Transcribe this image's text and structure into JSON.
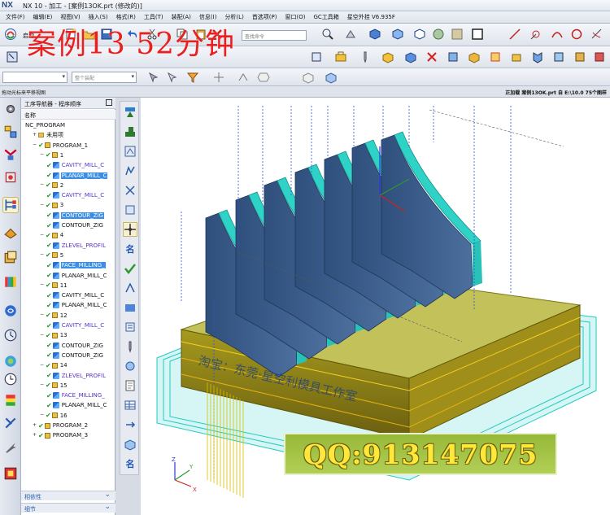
{
  "window": {
    "logo": "NX",
    "title": "NX 10 - 加工 - [案例13OK.prt (修改的)]"
  },
  "menu": [
    "文件(F)",
    "编辑(E)",
    "视图(V)",
    "插入(S)",
    "格式(R)",
    "工具(T)",
    "装配(A)",
    "信息(I)",
    "分析(L)",
    "首选项(P)",
    "窗口(O)",
    "GC工具箱",
    "星空外挂 V6.935F"
  ],
  "toolbar": {
    "start_label": "启动",
    "command_finder_placeholder": "查找命令",
    "filter_dropdown": "",
    "assembly_dropdown": "整个装配"
  },
  "watermark": "案例13  52分钟",
  "status": {
    "left": "拖动光标来平移视图",
    "right": "正加载 案例13OK.prt 自 E:\\10.0  75个图样"
  },
  "navigator": {
    "title": "工序导航器 - 程序顺序",
    "column": "名称",
    "rows": [
      {
        "level": 0,
        "text": "NC_PROGRAM",
        "kind": "root"
      },
      {
        "level": 1,
        "text": "未用项",
        "kind": "folder"
      },
      {
        "level": 1,
        "text": "PROGRAM_1",
        "kind": "program"
      },
      {
        "level": 2,
        "text": "1",
        "kind": "group"
      },
      {
        "level": 3,
        "text": "CAVITY_MILL_C",
        "kind": "op",
        "style": "purple"
      },
      {
        "level": 3,
        "text": "PLANAR_MILL_C",
        "kind": "op",
        "style": "sel"
      },
      {
        "level": 2,
        "text": "2",
        "kind": "group"
      },
      {
        "level": 3,
        "text": "CAVITY_MILL_C",
        "kind": "op",
        "style": "purple"
      },
      {
        "level": 2,
        "text": "3",
        "kind": "group"
      },
      {
        "level": 3,
        "text": "CONTOUR_ZIG",
        "kind": "op",
        "style": "sel"
      },
      {
        "level": 3,
        "text": "CONTOUR_ZIG",
        "kind": "op",
        "style": ""
      },
      {
        "level": 2,
        "text": "4",
        "kind": "group"
      },
      {
        "level": 3,
        "text": "ZLEVEL_PROFIL",
        "kind": "op",
        "style": "purple"
      },
      {
        "level": 2,
        "text": "5",
        "kind": "group"
      },
      {
        "level": 3,
        "text": "FACE_MILLING_",
        "kind": "op",
        "style": "sel"
      },
      {
        "level": 3,
        "text": "PLANAR_MILL_C",
        "kind": "op",
        "style": ""
      },
      {
        "level": 2,
        "text": "11",
        "kind": "group"
      },
      {
        "level": 3,
        "text": "CAVITY_MILL_C",
        "kind": "op",
        "style": ""
      },
      {
        "level": 3,
        "text": "PLANAR_MILL_C",
        "kind": "op",
        "style": ""
      },
      {
        "level": 2,
        "text": "12",
        "kind": "group"
      },
      {
        "level": 3,
        "text": "CAVITY_MILL_C",
        "kind": "op",
        "style": "purple"
      },
      {
        "level": 2,
        "text": "13",
        "kind": "group"
      },
      {
        "level": 3,
        "text": "CONTOUR_ZIG",
        "kind": "op",
        "style": ""
      },
      {
        "level": 3,
        "text": "CONTOUR_ZIG",
        "kind": "op",
        "style": ""
      },
      {
        "level": 2,
        "text": "14",
        "kind": "group"
      },
      {
        "level": 3,
        "text": "ZLEVEL_PROFIL",
        "kind": "op",
        "style": "purple"
      },
      {
        "level": 2,
        "text": "15",
        "kind": "group"
      },
      {
        "level": 3,
        "text": "FACE_MILLING_",
        "kind": "op",
        "style": "purple"
      },
      {
        "level": 3,
        "text": "PLANAR_MILL_C",
        "kind": "op",
        "style": ""
      },
      {
        "level": 2,
        "text": "16",
        "kind": "group"
      },
      {
        "level": 1,
        "text": "PROGRAM_2",
        "kind": "program"
      },
      {
        "level": 1,
        "text": "PROGRAM_3",
        "kind": "program"
      }
    ],
    "footer": [
      "相依性",
      "细节"
    ]
  },
  "vertical_strip": {
    "name_label_1": "名",
    "name_label_2": "名"
  },
  "viewport": {
    "overlay_text": "淘宝：东莞·星空利模具工作室",
    "triad_label_x": "X",
    "triad_label_y": "Y",
    "triad_label_z": "Z"
  },
  "qq_banner": "QQ:913147075",
  "colors": {
    "part_blue": "#3f5f8c",
    "toolpath_cyan": "#27d4c8",
    "base_olive": "#8f8a1a",
    "watermark_red": "#e82020",
    "selection_blue": "#3a8ee6"
  }
}
